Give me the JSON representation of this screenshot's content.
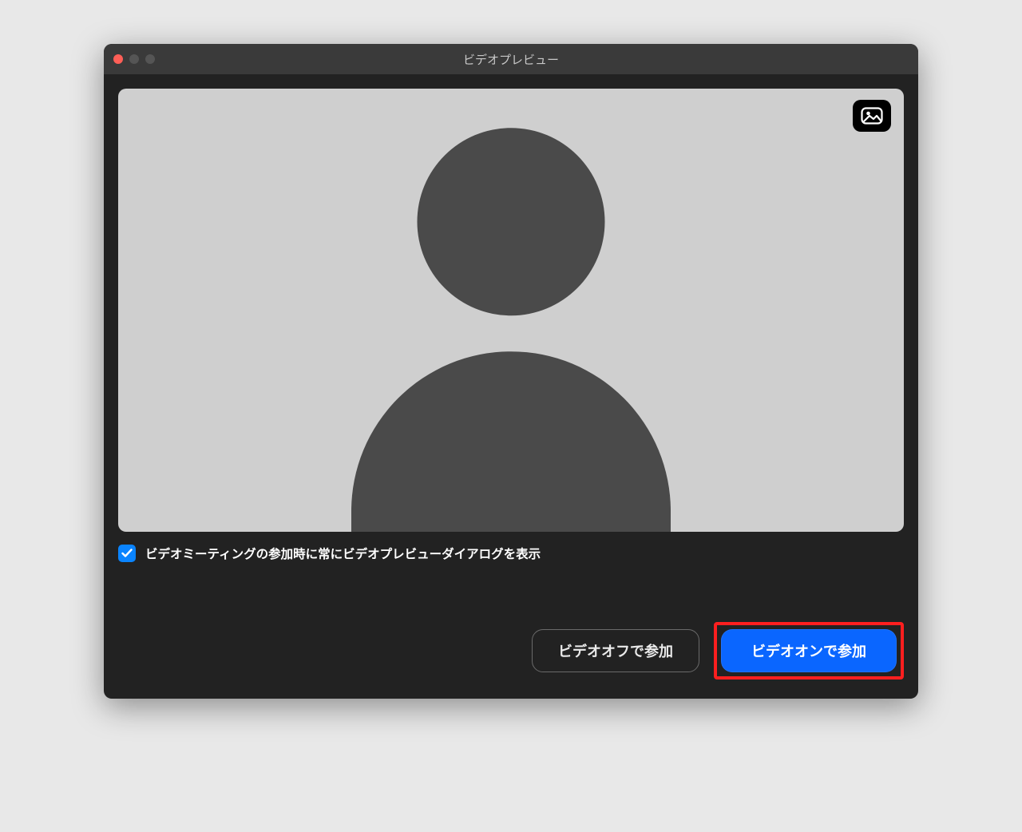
{
  "titlebar": {
    "title": "ビデオプレビュー"
  },
  "icons": {
    "background_button": "image-icon"
  },
  "checkbox": {
    "checked": true,
    "label": "ビデオミーティングの参加時に常にビデオプレビューダイアログを表示"
  },
  "buttons": {
    "video_off": "ビデオオフで参加",
    "video_on": "ビデオオンで参加"
  },
  "colors": {
    "accent": "#0a84ff",
    "primary_button": "#0a66ff",
    "highlight_border": "#ff1f1f"
  }
}
